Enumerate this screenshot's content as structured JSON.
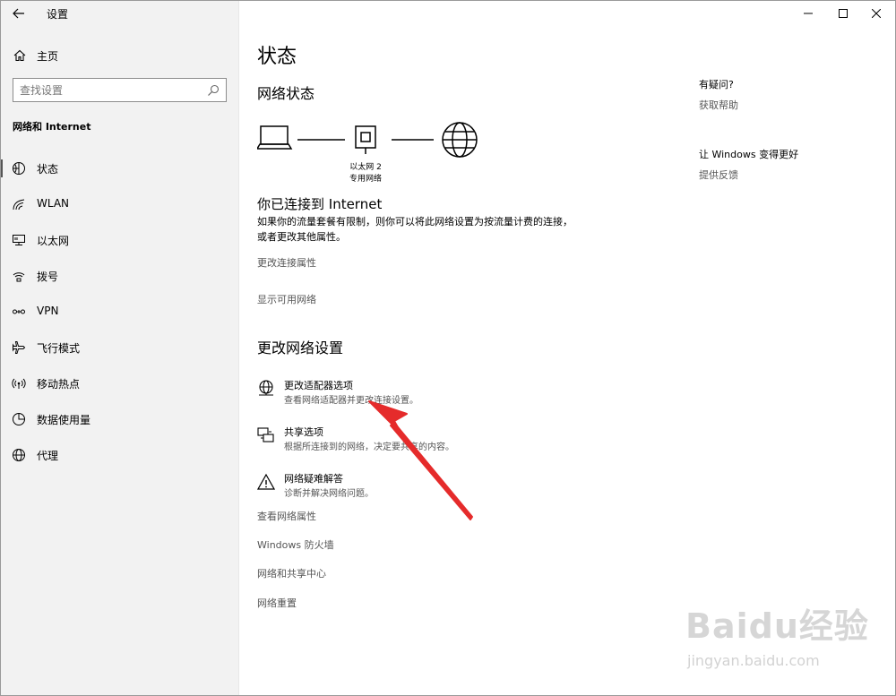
{
  "window": {
    "title": "设置"
  },
  "sidebar": {
    "home_label": "主页",
    "search_placeholder": "查找设置",
    "section_title": "网络和 Internet",
    "items": [
      {
        "label": "状态",
        "icon": "status-icon",
        "active": true
      },
      {
        "label": "WLAN",
        "icon": "wifi-icon"
      },
      {
        "label": "以太网",
        "icon": "ethernet-icon"
      },
      {
        "label": "拨号",
        "icon": "dialup-icon"
      },
      {
        "label": "VPN",
        "icon": "vpn-icon"
      },
      {
        "label": "飞行模式",
        "icon": "airplane-icon"
      },
      {
        "label": "移动热点",
        "icon": "hotspot-icon"
      },
      {
        "label": "数据使用量",
        "icon": "data-usage-icon"
      },
      {
        "label": "代理",
        "icon": "globe-icon"
      }
    ]
  },
  "main": {
    "page_title": "状态",
    "network_status_heading": "网络状态",
    "diagram": {
      "adapter_name": "以太网 2",
      "network_type": "专用网络"
    },
    "connected_heading": "你已连接到 Internet",
    "connected_desc": "如果你的流量套餐有限制，则你可以将此网络设置为按流量计费的连接，或者更改其他属性。",
    "link_change_props": "更改连接属性",
    "link_show_networks": "显示可用网络",
    "change_settings_heading": "更改网络设置",
    "options": [
      {
        "title": "更改适配器选项",
        "subtitle": "查看网络适配器并更改连接设置。",
        "icon": "adapter-icon"
      },
      {
        "title": "共享选项",
        "subtitle": "根据所连接到的网络，决定要共享的内容。",
        "icon": "sharing-icon"
      },
      {
        "title": "网络疑难解答",
        "subtitle": "诊断并解决网络问题。",
        "icon": "warning-icon"
      }
    ],
    "links": [
      "查看网络属性",
      "Windows 防火墙",
      "网络和共享中心",
      "网络重置"
    ]
  },
  "right_panel": {
    "question_heading": "有疑问?",
    "help_link": "获取帮助",
    "improve_heading": "让 Windows 变得更好",
    "feedback_link": "提供反馈"
  },
  "watermark": {
    "brand": "Baidu经验",
    "url": "jingyan.baidu.com"
  },
  "colors": {
    "sidebar_bg": "#f2f2f2",
    "annotation_arrow": "#e02020"
  }
}
